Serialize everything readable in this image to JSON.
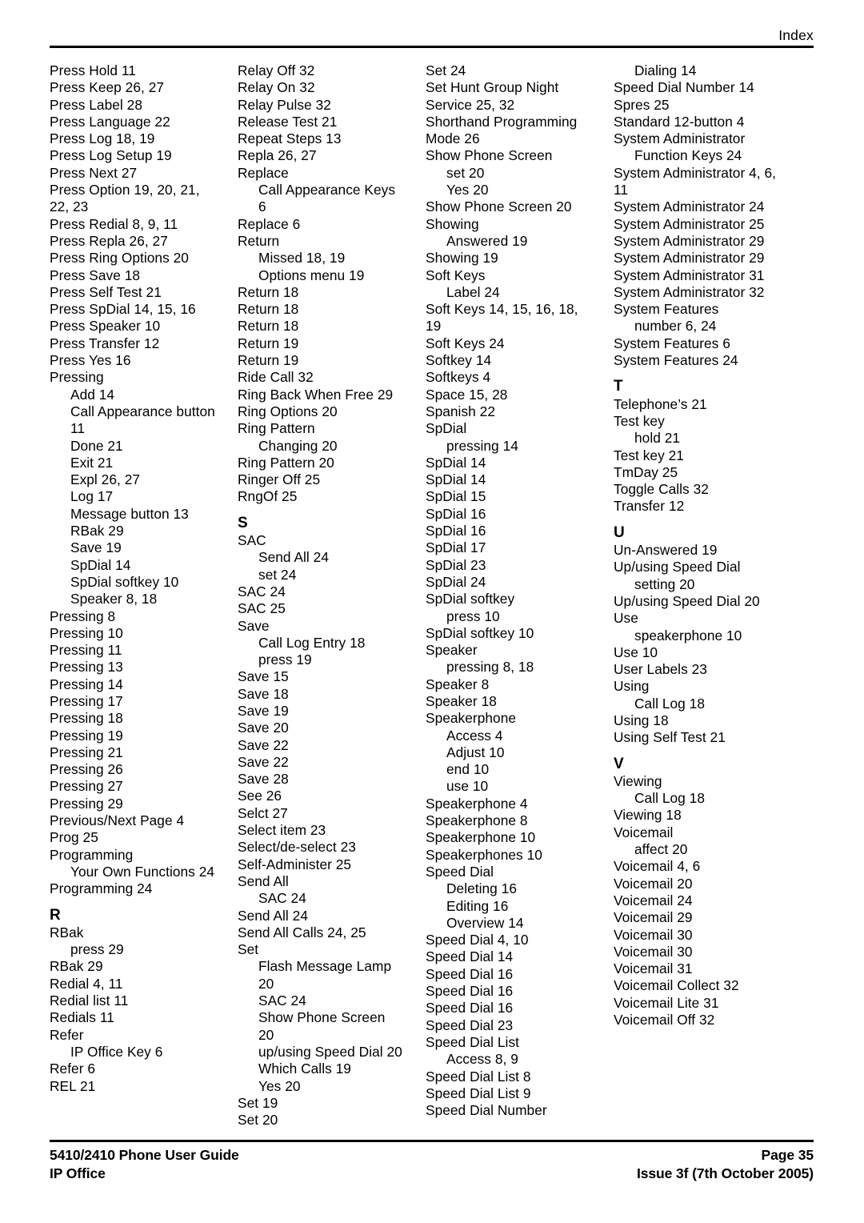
{
  "header": {
    "title": "Index"
  },
  "footer": {
    "left_line1": "5410/2410 Phone User Guide",
    "left_line2": "IP Office",
    "right_line1": "Page 35",
    "right_line2": "Issue 3f (7th October 2005)"
  },
  "columns": [
    {
      "id": "column-1",
      "entries": [
        {
          "level": 1,
          "text": "Press Hold 11"
        },
        {
          "level": 1,
          "text": "Press Keep 26, 27"
        },
        {
          "level": 1,
          "text": "Press Label 28"
        },
        {
          "level": 1,
          "text": "Press Language 22"
        },
        {
          "level": 1,
          "text": "Press Log 18, 19"
        },
        {
          "level": 1,
          "text": "Press Log Setup 19"
        },
        {
          "level": 1,
          "text": "Press Next 27"
        },
        {
          "level": 1,
          "text": "Press Option 19, 20, 21, 22, 23"
        },
        {
          "level": 1,
          "text": "Press Redial 8, 9, 11"
        },
        {
          "level": 1,
          "text": "Press Repla 26, 27"
        },
        {
          "level": 1,
          "text": "Press Ring Options 20"
        },
        {
          "level": 1,
          "text": "Press Save 18"
        },
        {
          "level": 1,
          "text": "Press Self Test 21"
        },
        {
          "level": 1,
          "text": "Press SpDial 14, 15, 16"
        },
        {
          "level": 1,
          "text": "Press Speaker 10"
        },
        {
          "level": 1,
          "text": "Press Transfer 12"
        },
        {
          "level": 1,
          "text": "Press Yes 16"
        },
        {
          "level": 1,
          "text": "Pressing"
        },
        {
          "level": 2,
          "text": "Add 14"
        },
        {
          "level": 2,
          "text": "Call Appearance button 11"
        },
        {
          "level": 2,
          "text": "Done 21"
        },
        {
          "level": 2,
          "text": "Exit 21"
        },
        {
          "level": 2,
          "text": "Expl 26, 27"
        },
        {
          "level": 2,
          "text": "Log 17"
        },
        {
          "level": 2,
          "text": "Message button 13"
        },
        {
          "level": 2,
          "text": "RBak 29"
        },
        {
          "level": 2,
          "text": "Save 19"
        },
        {
          "level": 2,
          "text": "SpDial 14"
        },
        {
          "level": 2,
          "text": "SpDial softkey 10"
        },
        {
          "level": 2,
          "text": "Speaker 8, 18"
        },
        {
          "level": 1,
          "text": "Pressing 8"
        },
        {
          "level": 1,
          "text": "Pressing 10"
        },
        {
          "level": 1,
          "text": "Pressing 11"
        },
        {
          "level": 1,
          "text": "Pressing 13"
        },
        {
          "level": 1,
          "text": "Pressing 14"
        },
        {
          "level": 1,
          "text": "Pressing 17"
        },
        {
          "level": 1,
          "text": "Pressing 18"
        },
        {
          "level": 1,
          "text": "Pressing 19"
        },
        {
          "level": 1,
          "text": "Pressing 21"
        },
        {
          "level": 1,
          "text": "Pressing 26"
        },
        {
          "level": 1,
          "text": "Pressing 27"
        },
        {
          "level": 1,
          "text": "Pressing 29"
        },
        {
          "level": 1,
          "text": "Previous/Next Page 4"
        },
        {
          "level": 1,
          "text": "Prog 25"
        },
        {
          "level": 1,
          "text": "Programming"
        },
        {
          "level": 2,
          "text": "Your Own Functions 24"
        },
        {
          "level": 1,
          "text": "Programming 24"
        },
        {
          "level": 0,
          "text": "R"
        },
        {
          "level": 1,
          "text": "RBak"
        },
        {
          "level": 2,
          "text": "press 29"
        },
        {
          "level": 1,
          "text": "RBak 29"
        },
        {
          "level": 1,
          "text": "Redial 4, 11"
        },
        {
          "level": 1,
          "text": "Redial list 11"
        },
        {
          "level": 1,
          "text": "Redials 11"
        },
        {
          "level": 1,
          "text": "Refer"
        },
        {
          "level": 2,
          "text": "IP Office Key 6"
        },
        {
          "level": 1,
          "text": "Refer 6"
        },
        {
          "level": 1,
          "text": "REL 21"
        }
      ]
    },
    {
      "id": "column-2",
      "entries": [
        {
          "level": 1,
          "text": "Relay Off 32"
        },
        {
          "level": 1,
          "text": "Relay On 32"
        },
        {
          "level": 1,
          "text": "Relay Pulse 32"
        },
        {
          "level": 1,
          "text": "Release Test 21"
        },
        {
          "level": 1,
          "text": "Repeat Steps 13"
        },
        {
          "level": 1,
          "text": "Repla 26, 27"
        },
        {
          "level": 1,
          "text": "Replace"
        },
        {
          "level": 2,
          "text": "Call Appearance Keys 6"
        },
        {
          "level": 1,
          "text": "Replace 6"
        },
        {
          "level": 1,
          "text": "Return"
        },
        {
          "level": 2,
          "text": "Missed 18, 19"
        },
        {
          "level": 2,
          "text": "Options menu 19"
        },
        {
          "level": 1,
          "text": "Return 18"
        },
        {
          "level": 1,
          "text": "Return 18"
        },
        {
          "level": 1,
          "text": "Return 18"
        },
        {
          "level": 1,
          "text": "Return 19"
        },
        {
          "level": 1,
          "text": "Return 19"
        },
        {
          "level": 1,
          "text": "Ride Call 32"
        },
        {
          "level": 1,
          "text": "Ring Back When Free 29"
        },
        {
          "level": 1,
          "text": "Ring Options 20"
        },
        {
          "level": 1,
          "text": "Ring Pattern"
        },
        {
          "level": 2,
          "text": "Changing 20"
        },
        {
          "level": 1,
          "text": "Ring Pattern 20"
        },
        {
          "level": 1,
          "text": "Ringer Off 25"
        },
        {
          "level": 1,
          "text": "RngOf 25"
        },
        {
          "level": 0,
          "text": "S"
        },
        {
          "level": 1,
          "text": "SAC"
        },
        {
          "level": 2,
          "text": "Send All 24"
        },
        {
          "level": 2,
          "text": "set 24"
        },
        {
          "level": 1,
          "text": "SAC 24"
        },
        {
          "level": 1,
          "text": "SAC 25"
        },
        {
          "level": 1,
          "text": "Save"
        },
        {
          "level": 2,
          "text": "Call Log Entry 18"
        },
        {
          "level": 2,
          "text": "press 19"
        },
        {
          "level": 1,
          "text": "Save 15"
        },
        {
          "level": 1,
          "text": "Save 18"
        },
        {
          "level": 1,
          "text": "Save 19"
        },
        {
          "level": 1,
          "text": "Save 20"
        },
        {
          "level": 1,
          "text": "Save 22"
        },
        {
          "level": 1,
          "text": "Save 22"
        },
        {
          "level": 1,
          "text": "Save 28"
        },
        {
          "level": 1,
          "text": "See 26"
        },
        {
          "level": 1,
          "text": "Selct 27"
        },
        {
          "level": 1,
          "text": "Select item 23"
        },
        {
          "level": 1,
          "text": "Select/de-select 23"
        },
        {
          "level": 1,
          "text": "Self-Administer 25"
        },
        {
          "level": 1,
          "text": "Send All"
        },
        {
          "level": 2,
          "text": "SAC 24"
        },
        {
          "level": 1,
          "text": "Send All 24"
        },
        {
          "level": 1,
          "text": "Send All Calls 24, 25"
        },
        {
          "level": 1,
          "text": "Set"
        },
        {
          "level": 2,
          "text": "Flash Message Lamp 20"
        },
        {
          "level": 2,
          "text": "SAC 24"
        },
        {
          "level": 2,
          "text": "Show Phone Screen 20"
        },
        {
          "level": 2,
          "text": "up/using Speed Dial 20"
        },
        {
          "level": 2,
          "text": "Which Calls 19"
        },
        {
          "level": 2,
          "text": "Yes 20"
        },
        {
          "level": 1,
          "text": "Set 19"
        },
        {
          "level": 1,
          "text": "Set 20"
        }
      ]
    },
    {
      "id": "column-3",
      "entries": [
        {
          "level": 1,
          "text": "Set 24"
        },
        {
          "level": 1,
          "text": "Set Hunt Group Night Service 25, 32"
        },
        {
          "level": 1,
          "text": "Shorthand Programming Mode 26"
        },
        {
          "level": 1,
          "text": "Show Phone Screen"
        },
        {
          "level": 2,
          "text": "set 20"
        },
        {
          "level": 2,
          "text": "Yes 20"
        },
        {
          "level": 1,
          "text": "Show Phone Screen 20"
        },
        {
          "level": 1,
          "text": "Showing"
        },
        {
          "level": 2,
          "text": "Answered 19"
        },
        {
          "level": 1,
          "text": "Showing 19"
        },
        {
          "level": 1,
          "text": "Soft Keys"
        },
        {
          "level": 2,
          "text": "Label 24"
        },
        {
          "level": 1,
          "text": "Soft Keys 14, 15, 16, 18, 19"
        },
        {
          "level": 1,
          "text": "Soft Keys 24"
        },
        {
          "level": 1,
          "text": "Softkey 14"
        },
        {
          "level": 1,
          "text": "Softkeys 4"
        },
        {
          "level": 1,
          "text": "Space 15, 28"
        },
        {
          "level": 1,
          "text": "Spanish 22"
        },
        {
          "level": 1,
          "text": "SpDial"
        },
        {
          "level": 2,
          "text": "pressing 14"
        },
        {
          "level": 1,
          "text": "SpDial 14"
        },
        {
          "level": 1,
          "text": "SpDial 14"
        },
        {
          "level": 1,
          "text": "SpDial 15"
        },
        {
          "level": 1,
          "text": "SpDial 16"
        },
        {
          "level": 1,
          "text": "SpDial 16"
        },
        {
          "level": 1,
          "text": "SpDial 17"
        },
        {
          "level": 1,
          "text": "SpDial 23"
        },
        {
          "level": 1,
          "text": "SpDial 24"
        },
        {
          "level": 1,
          "text": "SpDial softkey"
        },
        {
          "level": 2,
          "text": "press 10"
        },
        {
          "level": 1,
          "text": "SpDial softkey 10"
        },
        {
          "level": 1,
          "text": "Speaker"
        },
        {
          "level": 2,
          "text": "pressing 8, 18"
        },
        {
          "level": 1,
          "text": "Speaker 8"
        },
        {
          "level": 1,
          "text": "Speaker 18"
        },
        {
          "level": 1,
          "text": "Speakerphone"
        },
        {
          "level": 2,
          "text": "Access 4"
        },
        {
          "level": 2,
          "text": "Adjust 10"
        },
        {
          "level": 2,
          "text": "end 10"
        },
        {
          "level": 2,
          "text": "use 10"
        },
        {
          "level": 1,
          "text": "Speakerphone 4"
        },
        {
          "level": 1,
          "text": "Speakerphone 8"
        },
        {
          "level": 1,
          "text": "Speakerphone 10"
        },
        {
          "level": 1,
          "text": "Speakerphones 10"
        },
        {
          "level": 1,
          "text": "Speed Dial"
        },
        {
          "level": 2,
          "text": "Deleting 16"
        },
        {
          "level": 2,
          "text": "Editing 16"
        },
        {
          "level": 2,
          "text": "Overview 14"
        },
        {
          "level": 1,
          "text": "Speed Dial 4, 10"
        },
        {
          "level": 1,
          "text": "Speed Dial 14"
        },
        {
          "level": 1,
          "text": "Speed Dial 16"
        },
        {
          "level": 1,
          "text": "Speed Dial 16"
        },
        {
          "level": 1,
          "text": "Speed Dial 16"
        },
        {
          "level": 1,
          "text": "Speed Dial 23"
        },
        {
          "level": 1,
          "text": "Speed Dial List"
        },
        {
          "level": 2,
          "text": "Access 8, 9"
        },
        {
          "level": 1,
          "text": "Speed Dial List 8"
        },
        {
          "level": 1,
          "text": "Speed Dial List 9"
        },
        {
          "level": 1,
          "text": "Speed Dial Number"
        }
      ]
    },
    {
      "id": "column-4",
      "entries": [
        {
          "level": 2,
          "text": "Dialing 14"
        },
        {
          "level": 1,
          "text": "Speed Dial Number 14"
        },
        {
          "level": 1,
          "text": "Spres 25"
        },
        {
          "level": 1,
          "text": "Standard 12-button 4"
        },
        {
          "level": 1,
          "text": "System Administrator"
        },
        {
          "level": 2,
          "text": "Function Keys 24"
        },
        {
          "level": 1,
          "text": "System Administrator 4, 6, 11"
        },
        {
          "level": 1,
          "text": "System Administrator 24"
        },
        {
          "level": 1,
          "text": "System Administrator 25"
        },
        {
          "level": 1,
          "text": "System Administrator 29"
        },
        {
          "level": 1,
          "text": "System Administrator 29"
        },
        {
          "level": 1,
          "text": "System Administrator 31"
        },
        {
          "level": 1,
          "text": "System Administrator 32"
        },
        {
          "level": 1,
          "text": "System Features"
        },
        {
          "level": 2,
          "text": "number 6, 24"
        },
        {
          "level": 1,
          "text": "System Features 6"
        },
        {
          "level": 1,
          "text": "System Features 24"
        },
        {
          "level": 0,
          "text": "T"
        },
        {
          "level": 1,
          "text": "Telephone’s 21"
        },
        {
          "level": 1,
          "text": "Test key"
        },
        {
          "level": 2,
          "text": "hold 21"
        },
        {
          "level": 1,
          "text": "Test key 21"
        },
        {
          "level": 1,
          "text": "TmDay 25"
        },
        {
          "level": 1,
          "text": "Toggle Calls 32"
        },
        {
          "level": 1,
          "text": "Transfer 12"
        },
        {
          "level": 0,
          "text": "U"
        },
        {
          "level": 1,
          "text": "Un-Answered 19"
        },
        {
          "level": 1,
          "text": "Up/using Speed Dial"
        },
        {
          "level": 2,
          "text": "setting 20"
        },
        {
          "level": 1,
          "text": "Up/using Speed Dial 20"
        },
        {
          "level": 1,
          "text": "Use"
        },
        {
          "level": 2,
          "text": "speakerphone 10"
        },
        {
          "level": 1,
          "text": "Use 10"
        },
        {
          "level": 1,
          "text": "User Labels 23"
        },
        {
          "level": 1,
          "text": "Using"
        },
        {
          "level": 2,
          "text": "Call Log 18"
        },
        {
          "level": 1,
          "text": "Using 18"
        },
        {
          "level": 1,
          "text": "Using Self Test 21"
        },
        {
          "level": 0,
          "text": "V"
        },
        {
          "level": 1,
          "text": "Viewing"
        },
        {
          "level": 2,
          "text": "Call Log 18"
        },
        {
          "level": 1,
          "text": "Viewing 18"
        },
        {
          "level": 1,
          "text": "Voicemail"
        },
        {
          "level": 2,
          "text": "affect 20"
        },
        {
          "level": 1,
          "text": "Voicemail 4, 6"
        },
        {
          "level": 1,
          "text": "Voicemail 20"
        },
        {
          "level": 1,
          "text": "Voicemail 24"
        },
        {
          "level": 1,
          "text": "Voicemail 29"
        },
        {
          "level": 1,
          "text": "Voicemail 30"
        },
        {
          "level": 1,
          "text": "Voicemail 30"
        },
        {
          "level": 1,
          "text": "Voicemail 31"
        },
        {
          "level": 1,
          "text": "Voicemail Collect 32"
        },
        {
          "level": 1,
          "text": "Voicemail Lite 31"
        },
        {
          "level": 1,
          "text": "Voicemail Off 32"
        }
      ]
    }
  ]
}
